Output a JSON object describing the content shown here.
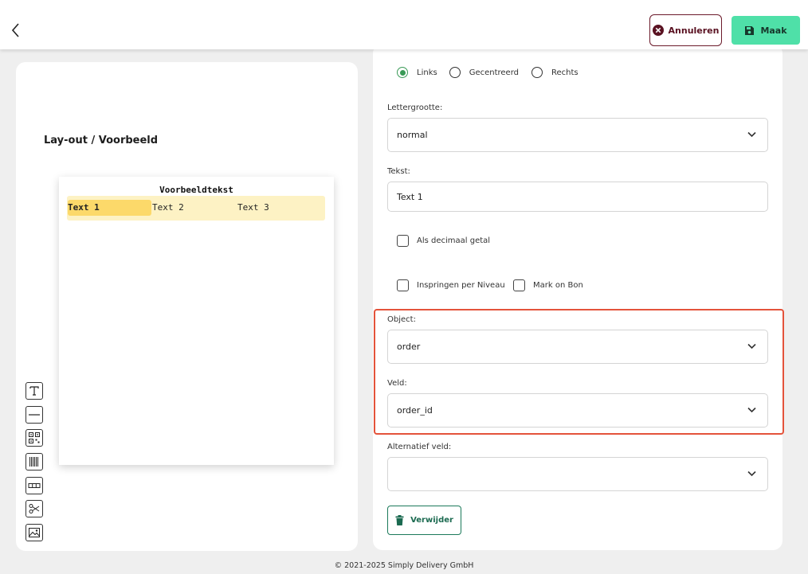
{
  "header": {
    "back_icon": "chevron-left-icon",
    "cancel_label": "Annuleren",
    "create_label": "Maak",
    "cancel_color": "#6b1a2a",
    "create_color": "#4fe0a8"
  },
  "preview": {
    "title": "Lay-out / Voorbeeld",
    "paper_title": "Voorbeeldtekst",
    "cells": [
      "Text 1",
      "Text 2",
      "Text 3"
    ],
    "selected_cell_color": "#fcd96a",
    "row_color": "#fdf2c4"
  },
  "tools": [
    "text-tool-icon",
    "line-tool-icon",
    "qr-code-tool-icon",
    "barcode-tool-icon",
    "table-row-tool-icon",
    "scissors-tool-icon",
    "image-tool-icon"
  ],
  "form": {
    "alignment": {
      "options": [
        "Links",
        "Gecentreerd",
        "Rechts"
      ],
      "selected": "Links"
    },
    "font_size_label": "Lettergrootte:",
    "font_size_value": "normal",
    "text_label": "Tekst:",
    "text_value": "Text 1",
    "decimal_label": "Als decimaal getal",
    "indent_label": "Inspringen per Niveau",
    "mark_label": "Mark on Bon",
    "object_label": "Object:",
    "object_value": "order",
    "field_label": "Veld:",
    "field_value": "order_id",
    "alt_field_label": "Alternatief veld:",
    "alt_field_value": "",
    "delete_label": "Verwijder",
    "highlight_color": "#e4533b"
  },
  "footer": "© 2021-2025 Simply Delivery GmbH"
}
